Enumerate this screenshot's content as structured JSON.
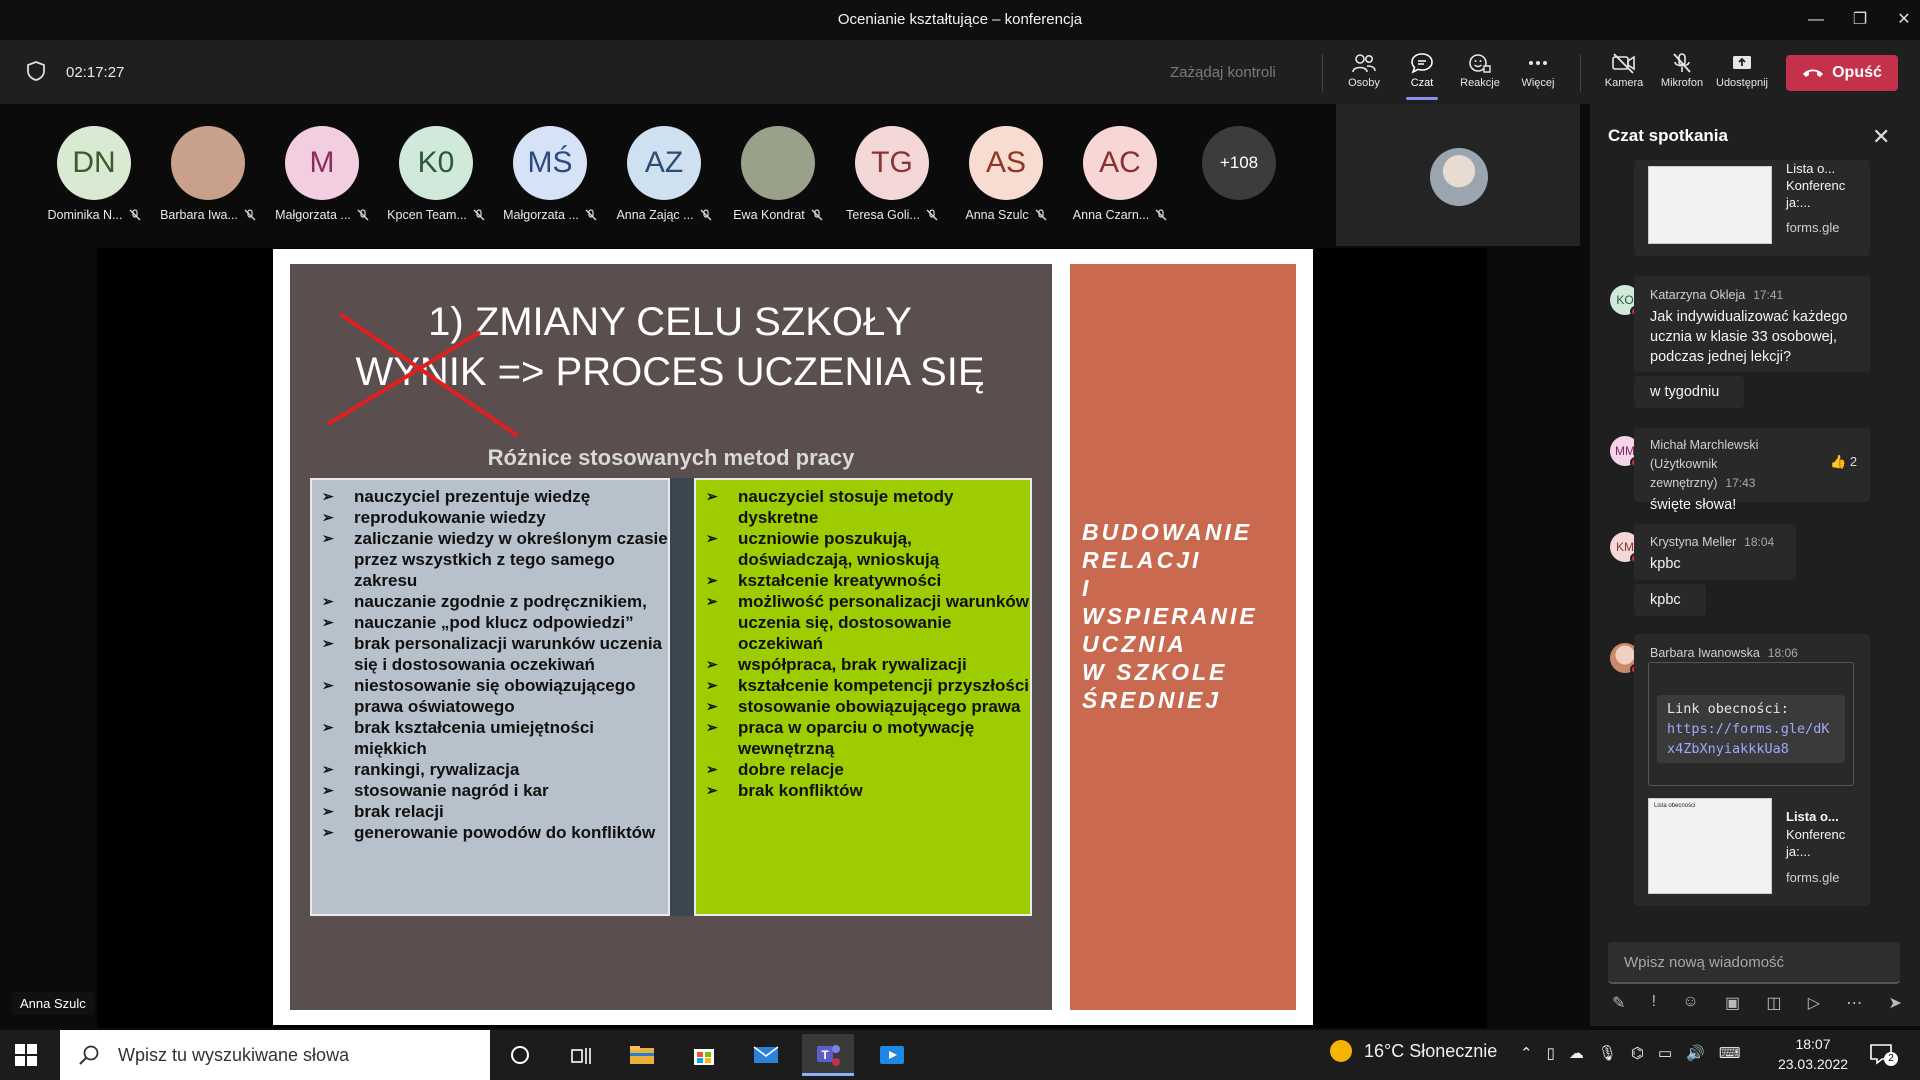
{
  "window": {
    "title": "Ocenianie kształtujące – konferencja",
    "minimize": "—",
    "restore": "❐",
    "close": "✕"
  },
  "toolbar": {
    "timer": "02:17:27",
    "request_control": "Zażądaj kontroli",
    "people": "Osoby",
    "chat": "Czat",
    "reactions": "Reakcje",
    "more": "Więcej",
    "camera": "Kamera",
    "mic": "Mikrofon",
    "share": "Udostępnij",
    "leave": "Opuść"
  },
  "participants": [
    {
      "initials": "DN",
      "name": "Dominika N...",
      "bg": "#d9ead3",
      "fg": "#3b5b2c"
    },
    {
      "initials": "",
      "name": "Barbara Iwa...",
      "bg": "#c9a08a",
      "fg": "#333"
    },
    {
      "initials": "M",
      "name": "Małgorzata ...",
      "bg": "#f3cde0",
      "fg": "#8a2d5e"
    },
    {
      "initials": "K0",
      "name": "Kpcen Team...",
      "bg": "#d0e9da",
      "fg": "#2a5a3c"
    },
    {
      "initials": "MŚ",
      "name": "Małgorzata ...",
      "bg": "#d6e2f5",
      "fg": "#2c4a80"
    },
    {
      "initials": "AZ",
      "name": "Anna Zając ...",
      "bg": "#cfe0f0",
      "fg": "#2b4d73"
    },
    {
      "initials": "",
      "name": "Ewa Kondrat",
      "bg": "#9aa18a",
      "fg": "#333"
    },
    {
      "initials": "TG",
      "name": "Teresa Goli...",
      "bg": "#f4d7d7",
      "fg": "#8a3434"
    },
    {
      "initials": "AS",
      "name": "Anna Szulc",
      "bg": "#f8dcd2",
      "fg": "#8a3a22"
    },
    {
      "initials": "AC",
      "name": "Anna Czarn...",
      "bg": "#f8d6d6",
      "fg": "#8a2f2f"
    }
  ],
  "more_participants": "+108",
  "slide": {
    "title_line1": "1) ZMIANY CELU SZKOŁY",
    "title_line2": "WYNIK => PROCES UCZENIA SIĘ",
    "subtitle": "Różnice stosowanych metod pracy",
    "left_items": [
      "nauczyciel prezentuje wiedzę",
      "reprodukowanie wiedzy",
      "zaliczanie wiedzy w określonym czasie przez wszystkich z tego samego zakresu",
      "nauczanie zgodnie z podręcznikiem,",
      "nauczanie „pod klucz odpowiedzi”",
      "brak personalizacji warunków uczenia się i dostosowania oczekiwań",
      "niestosowanie się obowiązującego prawa oświatowego",
      "brak kształcenia umiejętności miękkich",
      "rankingi, rywalizacja",
      "stosowanie nagród i kar",
      "brak relacji",
      "generowanie powodów do konfliktów"
    ],
    "right_items": [
      "nauczyciel stosuje metody dyskretne",
      "uczniowie poszukują, doświadczają, wnioskują",
      "kształcenie kreatywności",
      "możliwość personalizacji warunków uczenia się, dostosowanie oczekiwań",
      "współpraca, brak rywalizacji",
      "kształcenie kompetencji przyszłości",
      "stosowanie obowiązującego prawa",
      "praca w oparciu o motywację wewnętrzną",
      "dobre relacje",
      "brak konfliktów"
    ],
    "side_lines": [
      "BUDOWANIE",
      "RELACJI",
      "I",
      "WSPIERANIE",
      "UCZNIA",
      "W SZKOLE",
      "ŚREDNIEJ"
    ],
    "presenter": "Anna Szulc"
  },
  "chat": {
    "title": "Czat spotkania",
    "card_top": {
      "title": "Lista o...",
      "sub1": "Konferenc",
      "sub2": "ja:...",
      "domain": "forms.gle"
    },
    "msg1": {
      "initials": "KO",
      "author": "Katarzyna Okleja",
      "time": "17:41",
      "text": "Jak indywidualizować każdego ucznia w klasie 33 osobowej, podczas jednej lekcji?",
      "followup": "w tygodniu"
    },
    "msg2": {
      "initials": "MM",
      "author": "Michał Marchlewski (Użytkownik zewnętrzny)",
      "time": "17:43",
      "reaction_count": "2",
      "text": "święte słowa!"
    },
    "msg3": {
      "initials": "KM",
      "author": "Krystyna Meller",
      "time": "18:04",
      "text": "kpbc",
      "followup": "kpbc"
    },
    "msg4": {
      "author": "Barbara Iwanowska",
      "time": "18:06",
      "code_label": "Link obecności:",
      "code_url": "https://forms.gle/dKx4ZbXnyiakkkUa8",
      "card": {
        "title": "Lista o...",
        "sub1": "Konferenc",
        "sub2": "ja:...",
        "domain": "forms.gle",
        "thumb_title": "Lista obecności"
      }
    },
    "compose_placeholder": "Wpisz nową wiadomość"
  },
  "taskbar": {
    "search_placeholder": "Wpisz tu wyszukiwane słowa",
    "weather": "16°C  Słonecznie",
    "time": "18:07",
    "date": "23.03.2022",
    "notifications": "2"
  }
}
